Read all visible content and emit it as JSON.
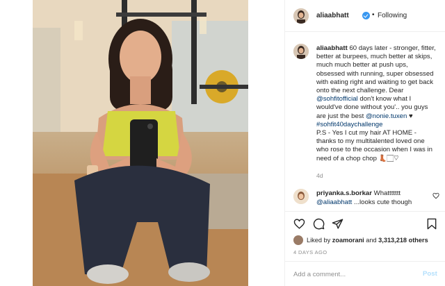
{
  "colors": {
    "verified": "#3897f0",
    "link": "#00376b",
    "muted": "#8e8e8e",
    "post_disabled": "#b2dffc"
  },
  "post": {
    "image": {
      "alt": ""
    },
    "header": {
      "username": "aliaabhatt",
      "separator": "•",
      "follow_status": "Following"
    },
    "caption": {
      "username": "aliaabhatt",
      "text1": "60 days later - stronger, fitter, better at burpees, much better at skips, much much better at push ups, obsessed with running, super obsessed with eating right and waiting to get back onto the next challenge. Dear ",
      "mention1": "@sohfitofficial",
      "text2": " don't know what I would've done without you'.. you guys are just the best ",
      "mention2": "@nonie.tuxen",
      "text3": " ♥",
      "hashtag": "#sohfit40daychallenge",
      "text4": "P.S - Yes I cut my hair AT HOME - thanks to my multitalented loved one who rose to the occasion when I was in need of a chop chop 👢🏻♡",
      "time": "4d"
    },
    "comment": {
      "username": "priyanka.s.borkar",
      "text1": " Whattttttt ",
      "mention": "@aliaabhatt",
      "text2": " ...looks cute though"
    },
    "actions": {
      "icons": [
        "heart-icon",
        "comment-icon",
        "share-icon",
        "bookmark-icon"
      ],
      "likes_prefix": "Liked by ",
      "likes_user": "zoamorani",
      "likes_mid": " and ",
      "likes_count": "3,313,218 others",
      "time_ago": "4 DAYS AGO"
    },
    "add_comment": {
      "placeholder": "Add a comment...",
      "post_label": "Post"
    }
  }
}
